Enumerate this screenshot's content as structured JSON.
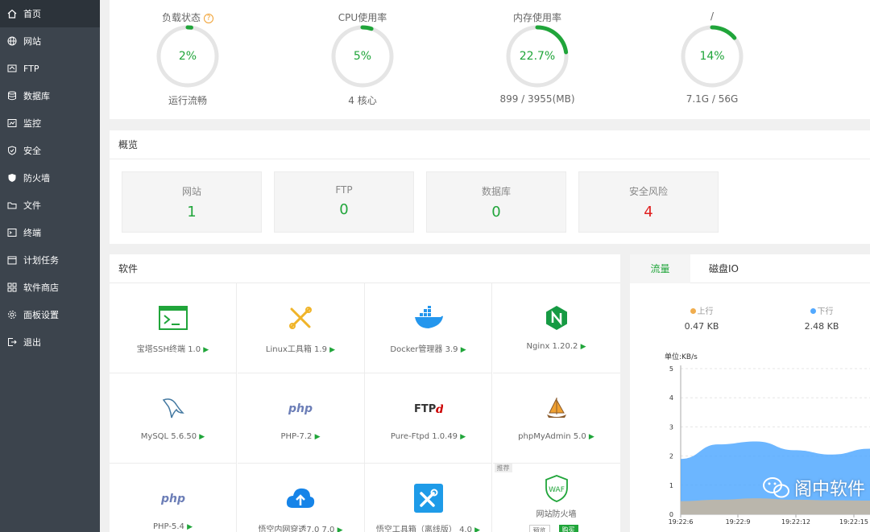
{
  "sidebar": {
    "items": [
      {
        "label": "首页",
        "icon": "home-icon",
        "active": true
      },
      {
        "label": "网站",
        "icon": "globe-icon"
      },
      {
        "label": "FTP",
        "icon": "ftp-icon"
      },
      {
        "label": "数据库",
        "icon": "database-icon"
      },
      {
        "label": "监控",
        "icon": "monitor-icon"
      },
      {
        "label": "安全",
        "icon": "shield-icon"
      },
      {
        "label": "防火墙",
        "icon": "firewall-icon"
      },
      {
        "label": "文件",
        "icon": "folder-icon"
      },
      {
        "label": "终端",
        "icon": "terminal-icon"
      },
      {
        "label": "计划任务",
        "icon": "calendar-icon"
      },
      {
        "label": "软件商店",
        "icon": "grid-icon"
      },
      {
        "label": "面板设置",
        "icon": "gear-icon"
      },
      {
        "label": "退出",
        "icon": "logout-icon"
      }
    ]
  },
  "gauges": [
    {
      "label": "负载状态",
      "value": "2%",
      "percent": 2,
      "sub": "运行流畅",
      "help": "?"
    },
    {
      "label": "CPU使用率",
      "value": "5%",
      "percent": 5,
      "sub": "4 核心"
    },
    {
      "label": "内存使用率",
      "value": "22.7%",
      "percent": 22.7,
      "sub": "899 / 3955(MB)"
    },
    {
      "label": "/",
      "value": "14%",
      "percent": 14,
      "sub": "7.1G / 56G"
    }
  ],
  "overview": {
    "title": "概览",
    "cards": [
      {
        "label": "网站",
        "value": "1"
      },
      {
        "label": "FTP",
        "value": "0"
      },
      {
        "label": "数据库",
        "value": "0"
      },
      {
        "label": "安全风险",
        "value": "4"
      }
    ]
  },
  "software": {
    "title": "软件",
    "items": [
      {
        "name": "宝塔SSH终端 1.0",
        "icon": "terminal-icon"
      },
      {
        "name": "Linux工具箱 1.9",
        "icon": "tools-icon"
      },
      {
        "name": "Docker管理器 3.9",
        "icon": "docker-icon"
      },
      {
        "name": "Nginx 1.20.2",
        "icon": "nginx-icon"
      },
      {
        "name": "MySQL 5.6.50",
        "icon": "mysql-dolphin-icon"
      },
      {
        "name": "PHP-7.2",
        "icon": "php-icon"
      },
      {
        "name": "Pure-Ftpd 1.0.49",
        "icon": "ftp-icon"
      },
      {
        "name": "phpMyAdmin 5.0",
        "icon": "phpmyadmin-icon"
      },
      {
        "name": "PHP-5.4",
        "icon": "php-icon"
      },
      {
        "name": "悟空内网穿透7.0 7.0",
        "icon": "cloud-upload-icon"
      },
      {
        "name": "悟空工具箱（离线版） 4.0",
        "icon": "wrench-icon"
      },
      {
        "name": "网站防火墙",
        "icon": "waf-shield-icon",
        "tag": "推荐",
        "btn1": "预览",
        "btn2": "购买"
      }
    ],
    "play": "▶"
  },
  "traffic": {
    "tabs": [
      "流量",
      "磁盘IO"
    ],
    "up_label": "上行",
    "up_value": "0.47 KB",
    "down_label": "下行",
    "down_value": "2.48 KB",
    "colors": {
      "up": "#f0ad4e",
      "down": "#52a9ff"
    }
  },
  "chart_data": {
    "type": "area",
    "ylabel": "单位:KB/s",
    "ylim": [
      0,
      5
    ],
    "yticks": [
      "0",
      "1",
      "2",
      "3",
      "4",
      "5"
    ],
    "x": [
      "19:22:6",
      "19:22:9",
      "19:22:12",
      "19:22:15"
    ],
    "series": [
      {
        "name": "下行",
        "color": "#52a9ff",
        "values": [
          1.9,
          2.4,
          2.5,
          2.2,
          2.05,
          2.25
        ]
      },
      {
        "name": "上行",
        "color": "#f0ad4e",
        "values": [
          0.45,
          0.5,
          0.55,
          0.5,
          0.48,
          0.47
        ]
      }
    ]
  },
  "watermark": "阁中软件"
}
